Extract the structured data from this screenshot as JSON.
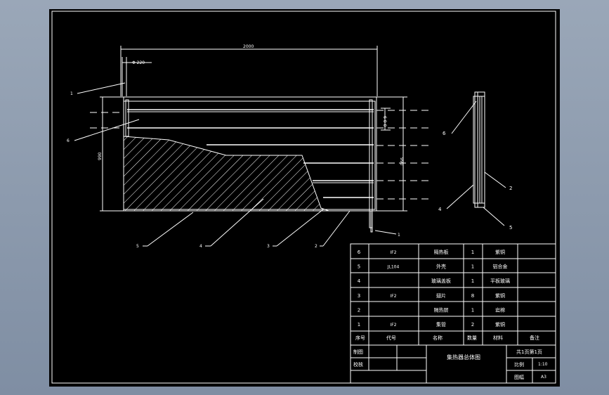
{
  "drawing": {
    "dimensions": {
      "overall_length": "2000",
      "small_dia": "Φ 220",
      "left_height": "990",
      "right_height": "990",
      "bar_spacing": "6 0 0"
    },
    "callouts": {
      "front_view": [
        "1",
        "6",
        "5",
        "4",
        "3",
        "2",
        "1"
      ],
      "side_view": [
        "6",
        "2",
        "4",
        "5"
      ]
    }
  },
  "bom": {
    "rows": [
      {
        "no": "6",
        "code": "IF2",
        "name": "隔热板",
        "qty": "1",
        "material": "紫铜",
        "note": ""
      },
      {
        "no": "5",
        "code": "JL104",
        "name": "外壳",
        "qty": "1",
        "material": "铝合金",
        "note": ""
      },
      {
        "no": "4",
        "code": "",
        "name": "玻璃盖板",
        "qty": "1",
        "material": "平板玻璃",
        "note": ""
      },
      {
        "no": "3",
        "code": "IF2",
        "name": "翅片",
        "qty": "8",
        "material": "紫铜",
        "note": ""
      },
      {
        "no": "2",
        "code": "",
        "name": "隔热层",
        "qty": "1",
        "material": "岩棉",
        "note": ""
      },
      {
        "no": "1",
        "code": "IF2",
        "name": "集管",
        "qty": "2",
        "material": "紫铜",
        "note": ""
      }
    ],
    "header": {
      "no": "序号",
      "code": "代号",
      "name": "名称",
      "qty": "数量",
      "material": "材料",
      "note": "备注"
    }
  },
  "title_block": {
    "drawn": "制图",
    "checked": "校核",
    "title": "集热器总体图",
    "sheet": "共1页第1页",
    "scale_label": "比例",
    "scale_value": "1:10",
    "size_label": "图幅",
    "size_value": "A3"
  }
}
